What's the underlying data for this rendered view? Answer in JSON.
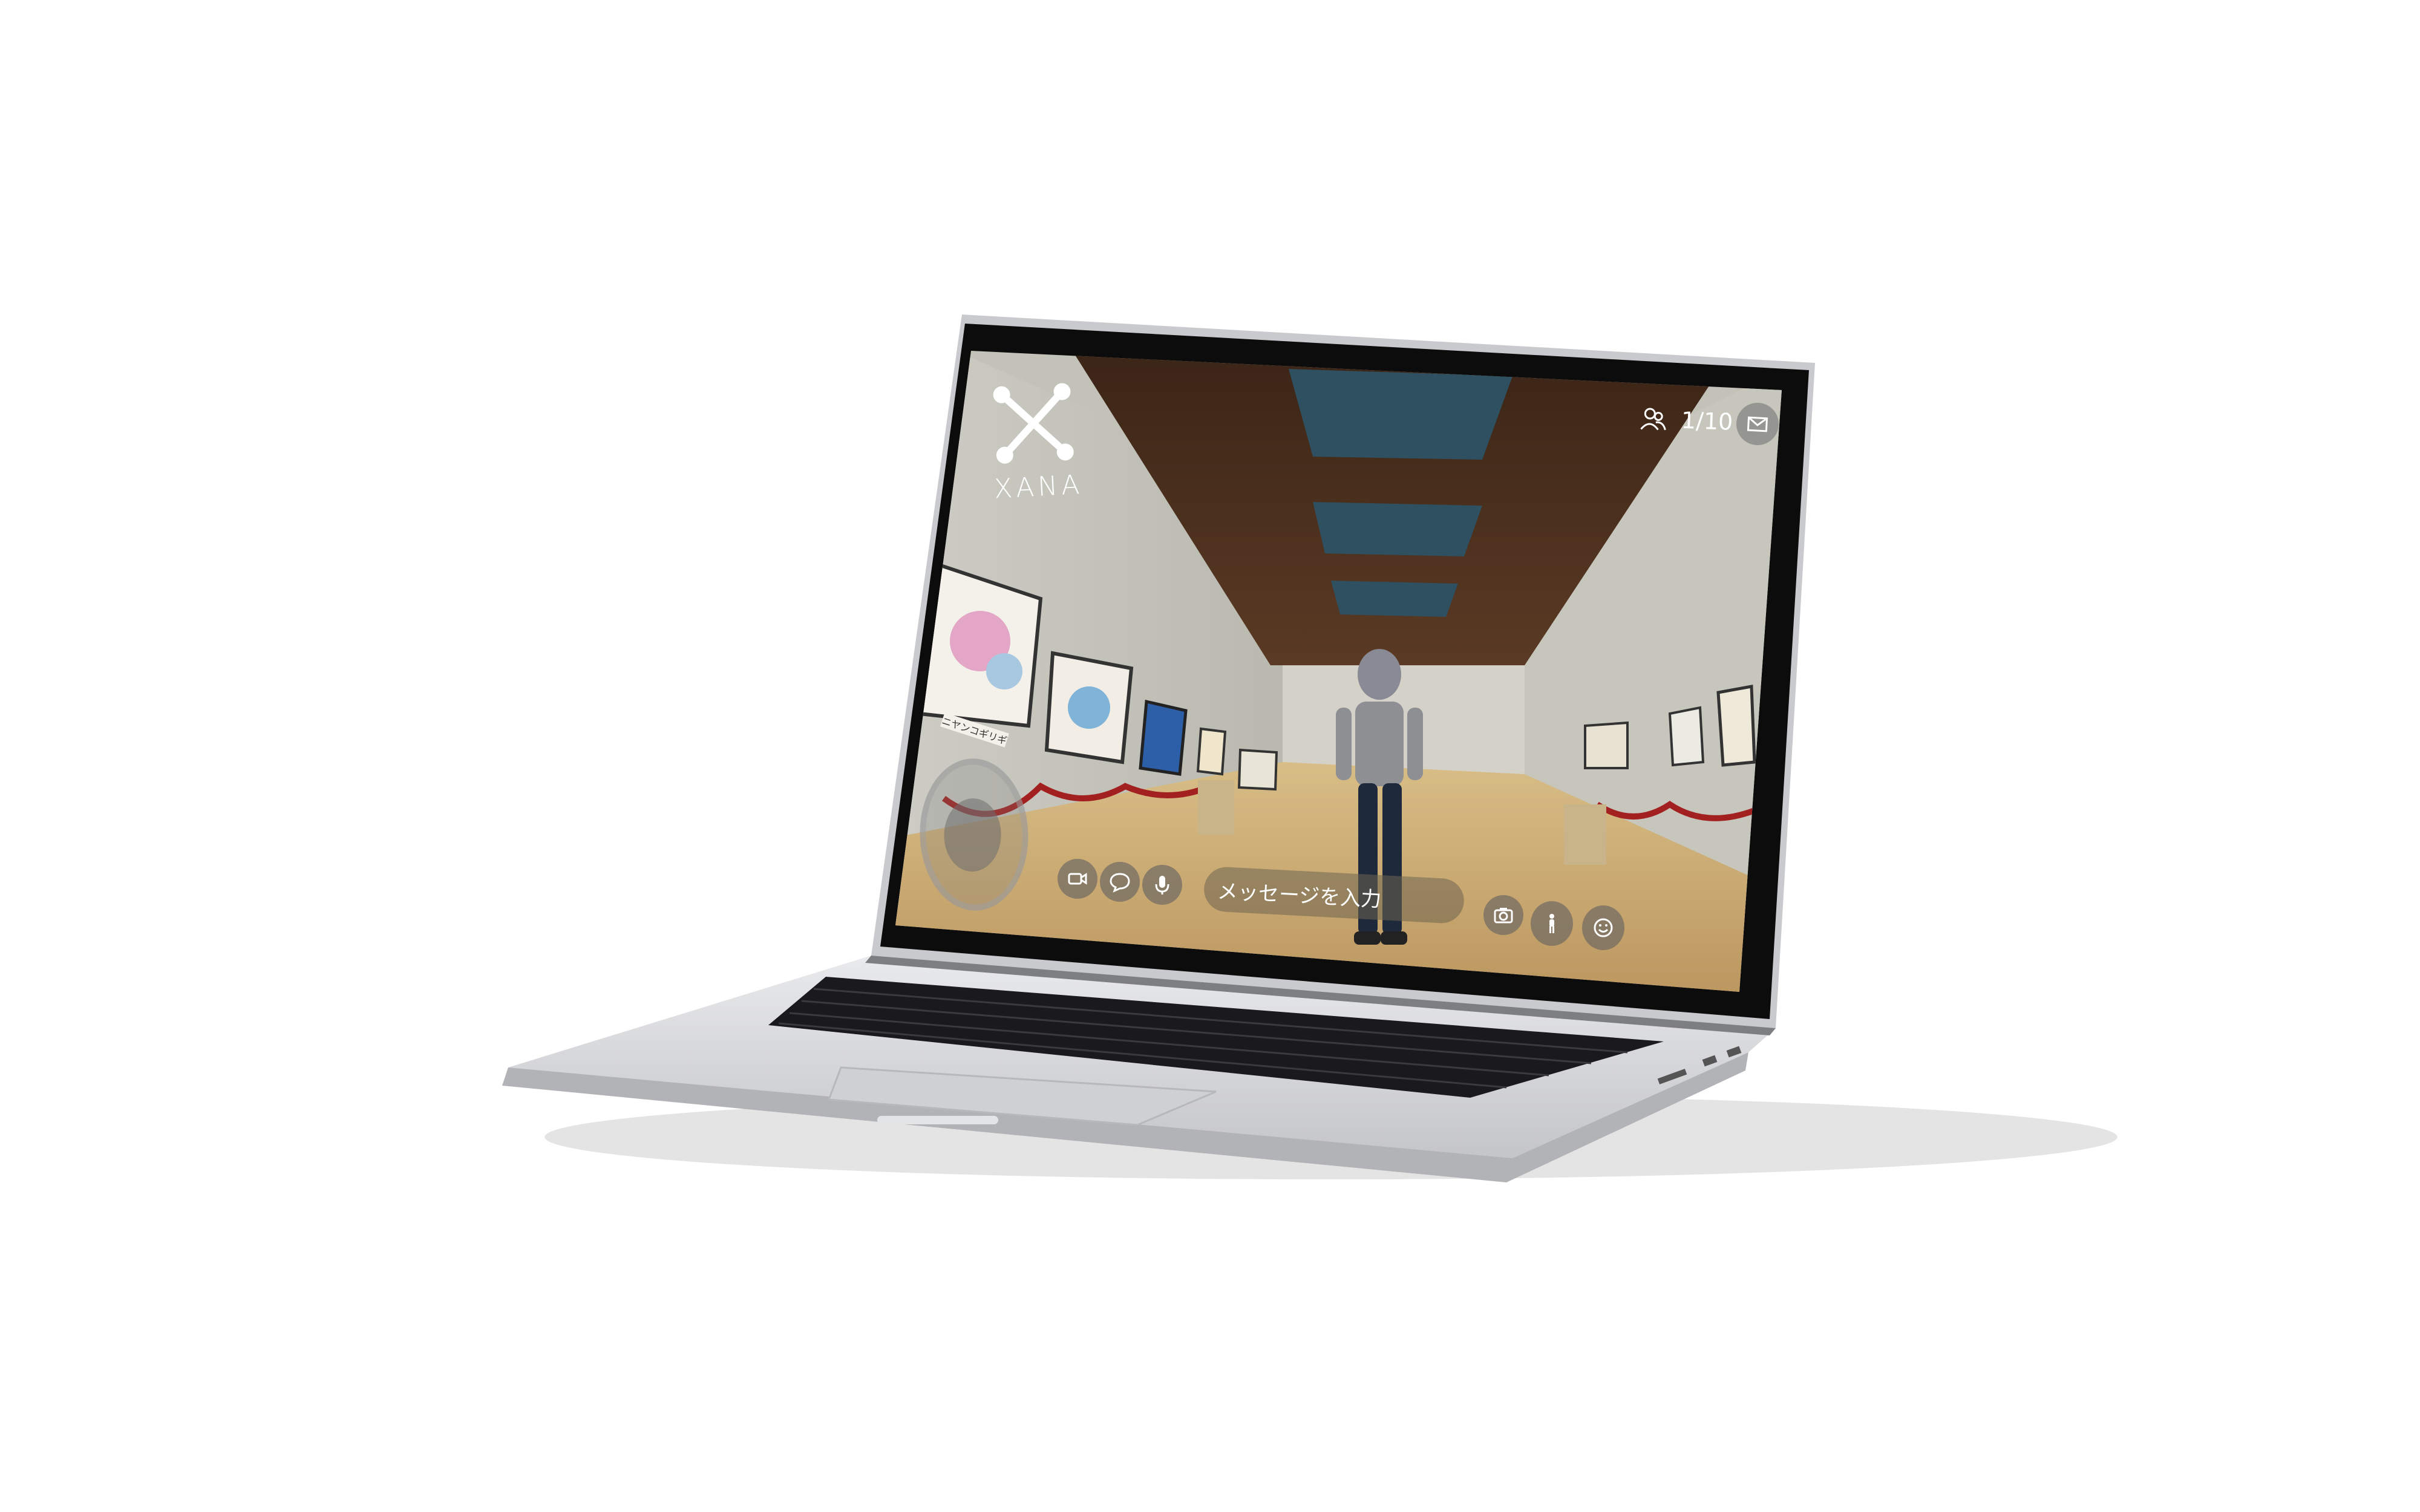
{
  "app": {
    "logo_text": "XANA",
    "player_count": "1/10",
    "message_placeholder": "メッセージを入力",
    "painting_caption": "ニヤンコギリギ"
  },
  "icons": {
    "logo": "xana-logo-icon",
    "players": "people-icon",
    "mail": "mail-icon",
    "video": "video-camera-icon",
    "chat": "chat-bubble-icon",
    "mic": "microphone-icon",
    "camera": "camera-icon",
    "avatar": "person-icon",
    "emote": "smiley-icon"
  },
  "colors": {
    "laptop_body": "#d9dadc",
    "bezel": "#0c0c0c",
    "hud_button_bg": "#5f5f5f",
    "ceiling_wood": "#4a3020",
    "floor_wood": "#c9a66d"
  }
}
